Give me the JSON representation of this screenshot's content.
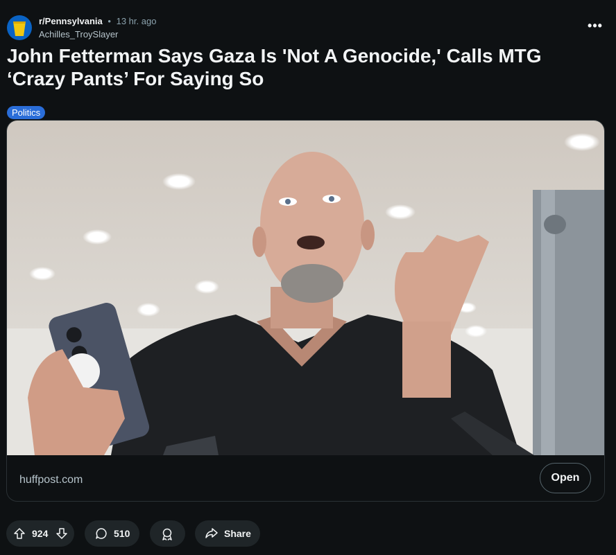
{
  "post": {
    "subreddit": "r/Pennsylvania",
    "separator": "•",
    "time": "13 hr. ago",
    "username": "Achilles_TroySlayer",
    "more_label": "•••",
    "title": "John Fetterman Says Gaza Is 'Not A Genocide,' Calls MTG ‘Crazy Pants’ For Saying So",
    "flair": "Politics"
  },
  "link": {
    "domain": "huffpost.com",
    "open_label": "Open"
  },
  "actions": {
    "vote_count": "924",
    "comment_count": "510",
    "share_label": "Share"
  },
  "icons": {
    "subreddit": "keystone-icon",
    "upvote": "arrow-up-icon",
    "downvote": "arrow-down-icon",
    "comment": "speech-bubble-icon",
    "award": "award-icon",
    "share": "share-arrow-icon",
    "more": "ellipsis-icon"
  },
  "colors": {
    "background": "#0e1113",
    "flair": "#2a6dd8",
    "pill": "#1f2528",
    "subreddit_icon": "#0a63c4",
    "keystone": "#f2c811"
  }
}
